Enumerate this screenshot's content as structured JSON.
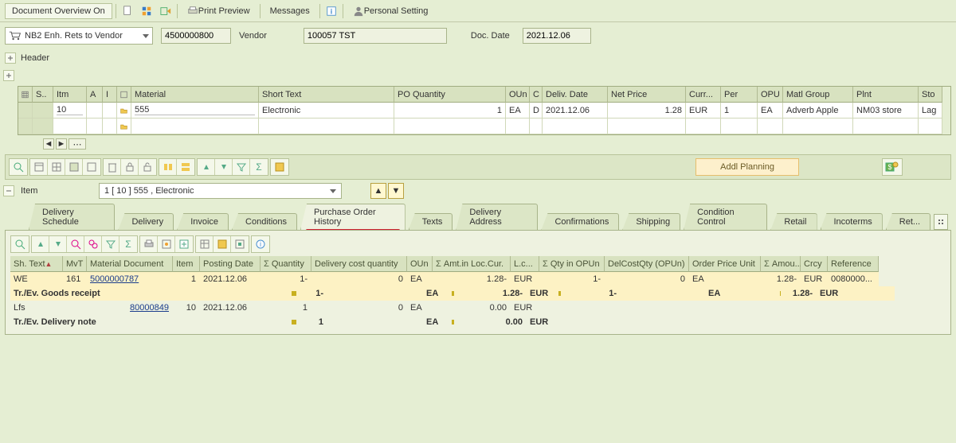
{
  "toolbar": {
    "doc_overview": "Document Overview On",
    "print_preview": "Print Preview",
    "messages": "Messages",
    "personal_setting": "Personal Setting"
  },
  "docHeader": {
    "doc_type": "NB2 Enh. Rets to Vendor",
    "po_number": "4500000800",
    "vendor_label": "Vendor",
    "vendor_value": "100057 TST",
    "doc_date_label": "Doc. Date",
    "doc_date_value": "2021.12.06",
    "header_label": "Header"
  },
  "itemGrid": {
    "headers": {
      "status": "S..",
      "itm": "Itm",
      "a": "A",
      "i": "I",
      "material": "Material",
      "short_text": "Short Text",
      "po_qty": "PO Quantity",
      "oun": "OUn",
      "c": "C",
      "deliv_date": "Deliv. Date",
      "net_price": "Net Price",
      "curr": "Curr...",
      "per": "Per",
      "opu": "OPU",
      "matl_group": "Matl Group",
      "plnt": "Plnt",
      "sto": "Sto"
    },
    "row": {
      "itm": "10",
      "material": "555",
      "short_text": "Electronic",
      "po_qty": "1",
      "oun": "EA",
      "c": "D",
      "deliv_date": "2021.12.06",
      "net_price": "1.28",
      "curr": "EUR",
      "per": "1",
      "opu": "EA",
      "matl_group": "Adverb Apple",
      "plnt": "NM03 store",
      "sto": "Lag"
    }
  },
  "midToolbar": {
    "addl_planning": "Addl Planning"
  },
  "itemSection": {
    "label": "Item",
    "selected": "1 [ 10 ] 555 , Electronic"
  },
  "tabs": {
    "delivery_schedule": "Delivery Schedule",
    "delivery": "Delivery",
    "invoice": "Invoice",
    "conditions": "Conditions",
    "po_history": "Purchase Order History",
    "texts": "Texts",
    "delivery_address": "Delivery Address",
    "confirmations": "Confirmations",
    "shipping": "Shipping",
    "condition_control": "Condition Control",
    "retail": "Retail",
    "incoterms": "Incoterms",
    "ret": "Ret..."
  },
  "history": {
    "headers": {
      "sh_text": "Sh. Text",
      "mvt": "MvT",
      "mat_doc": "Material Document",
      "item": "Item",
      "posting_date": "Posting Date",
      "quantity": "Quantity",
      "deliv_cost_qty": "Delivery cost quantity",
      "oun": "OUn",
      "amt_loc": "Amt.in Loc.Cur.",
      "lcur": "L.c...",
      "qty_opun": "Qty in OPUn",
      "delcost_opun": "DelCostQty (OPUn)",
      "order_price_unit": "Order Price Unit",
      "amount": "Amou...",
      "crcy": "Crcy",
      "reference": "Reference"
    },
    "rows": {
      "r1": {
        "sh": "WE",
        "mvt": "161",
        "doc": "5000000787",
        "item": "1",
        "date": "2021.12.06",
        "qty": "1-",
        "dcq": "0",
        "oun": "EA",
        "amt": "1.28-",
        "lcur": "EUR",
        "qopun": "1-",
        "dcopun": "0",
        "opu": "EA",
        "amount": "1.28-",
        "crcy": "EUR",
        "ref": "0080000..."
      },
      "r2": {
        "sh": "Tr./Ev. Goods receipt",
        "qty": "1-",
        "oun": "EA",
        "amt": "1.28-",
        "lcur": "EUR",
        "qopun": "1-",
        "opu": "EA",
        "amount": "1.28-",
        "crcy": "EUR"
      },
      "r3": {
        "sh": "Lfs",
        "doc": "80000849",
        "item": "10",
        "date": "2021.12.06",
        "qty": "1",
        "dcq": "0",
        "oun": "EA",
        "amt": "0.00",
        "lcur": "EUR"
      },
      "r4": {
        "sh": "Tr./Ev. Delivery note",
        "qty": "1",
        "oun": "EA",
        "amt": "0.00",
        "lcur": "EUR"
      }
    }
  },
  "sigma": "Σ"
}
